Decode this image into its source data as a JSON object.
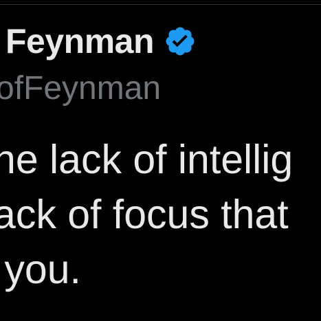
{
  "author": {
    "name": "Feynman",
    "handle": "ofFeynman",
    "verified_icon": "verified-badge-icon",
    "verified_color": "#1d9bf0"
  },
  "post": {
    "lines": [
      "he lack of intellig",
      "ack of focus that",
      " you."
    ]
  },
  "colors": {
    "background": "#000000",
    "primary_text": "#e7e9ea",
    "secondary_text": "#71767b",
    "divider": "#2f3336"
  }
}
